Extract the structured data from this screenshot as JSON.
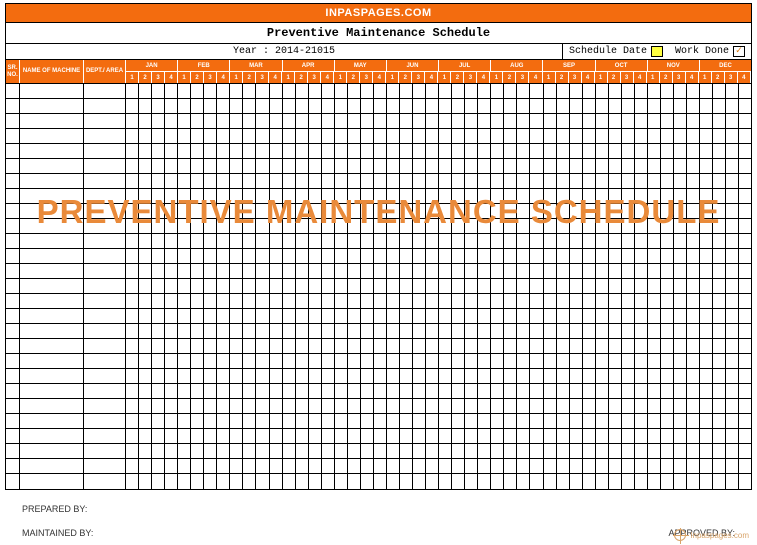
{
  "brand": "INPASPAGES.COM",
  "title": "Preventive Maintenance Schedule",
  "year_label": "Year : 2014-21015",
  "legend": {
    "schedule": "Schedule Date",
    "workdone": "Work Done",
    "check": "✓"
  },
  "head": {
    "sr": "SR. NO.",
    "name": "NAME OF MACHINE",
    "dept": "DEPT./ AREA"
  },
  "months": [
    "JAN",
    "FEB",
    "MAR",
    "APR",
    "MAY",
    "JUN",
    "JUL",
    "AUG",
    "SEP",
    "OCT",
    "NOV",
    "DEC"
  ],
  "weeks": [
    "1",
    "2",
    "3",
    "4"
  ],
  "row_count": 27,
  "watermark": "PREVENTIVE MAINTENANCE SCHEDULE",
  "signatures": {
    "prepared": "PREPARED BY:",
    "maintained": "MAINTAINED BY:",
    "approved": "APPROVED BY:"
  },
  "footer": "Inpaspages.com"
}
